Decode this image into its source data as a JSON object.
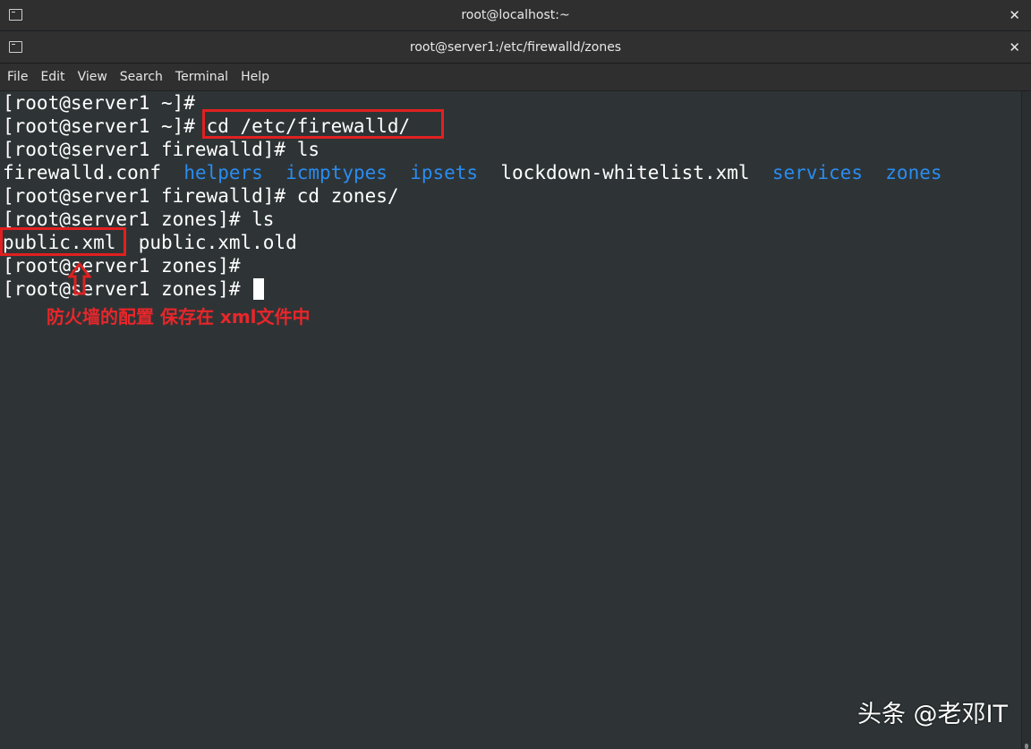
{
  "window": {
    "outer_title": "root@localhost:~",
    "inner_title": "root@server1:/etc/firewalld/zones",
    "close_glyph": "✕"
  },
  "menu": [
    "File",
    "Edit",
    "View",
    "Search",
    "Terminal",
    "Help"
  ],
  "terminal": {
    "lines": [
      "[root@server1 ~]#",
      "[root@server1 ~]# cd /etc/firewalld/",
      "[root@server1 firewalld]# ls",
      null,
      "[root@server1 firewalld]# cd zones/",
      "[root@server1 zones]# ls",
      "public.xml  public.xml.old",
      "[root@server1 zones]#",
      "[root@server1 zones]# "
    ],
    "ls_output": {
      "firewalld_conf": "firewalld.conf",
      "helpers": "helpers",
      "icmptypes": "icmptypes",
      "ipsets": "ipsets",
      "lockdown": "lockdown-whitelist.xml",
      "services": "services",
      "zones": "zones"
    },
    "colors": {
      "background": "#2e3436",
      "text": "#ffffff",
      "directory": "#2a8cf0"
    }
  },
  "annotation": {
    "text": "防火墙的配置 保存在 xml文件中",
    "color": "#e8262a"
  },
  "watermark": "头条 @老邓IT"
}
